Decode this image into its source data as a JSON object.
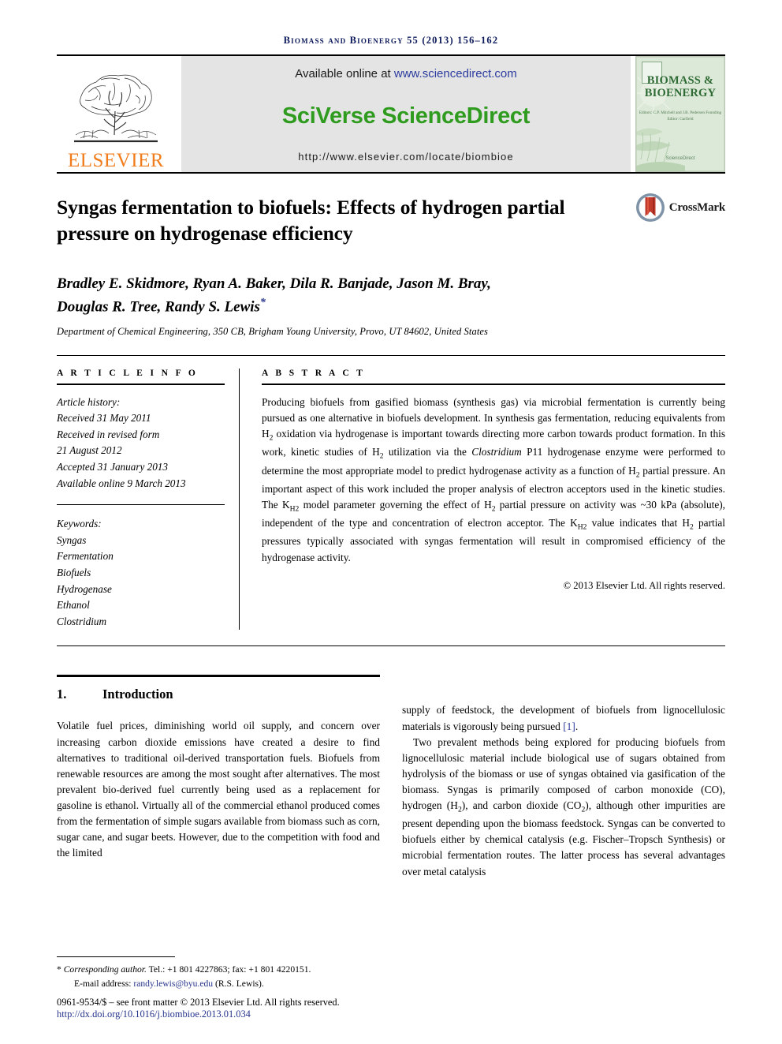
{
  "running_head": "Biomass and Bioenergy 55 (2013) 156–162",
  "banner": {
    "publisher_name": "ELSEVIER",
    "available_prefix": "Available online at ",
    "available_link": "www.sciencedirect.com",
    "platform_name": "SciVerse ScienceDirect",
    "journal_url": "http://www.elsevier.com/locate/biombioe",
    "cover": {
      "title_line1": "BIOMASS &",
      "title_line2": "BIOENERGY",
      "subtitle": "Editors: C.P. Mitchell and J.B. Pedersen\nFounding Editor: Garfield",
      "footer": "ScienceDirect"
    },
    "colors": {
      "elsevier_orange": "#f07c1b",
      "sciencedirect_green": "#2f9b1f",
      "link_blue": "#2b3b9e",
      "cover_green": "#2e6b34",
      "header_navy": "#0d1a5c"
    }
  },
  "article": {
    "title": "Syngas fermentation to biofuels: Effects of hydrogen partial pressure on hydrogenase efficiency",
    "crossmark_label": "CrossMark",
    "authors_line1": "Bradley E. Skidmore, Ryan A. Baker, Dila R. Banjade, Jason M. Bray,",
    "authors_line2": "Douglas R. Tree, Randy S. Lewis",
    "corresponding_marker": "*",
    "affiliation": "Department of Chemical Engineering, 350 CB, Brigham Young University, Provo, UT 84602, United States"
  },
  "article_info": {
    "heading": "A R T I C L E   I N F O",
    "history_label": "Article history:",
    "history": [
      "Received 31 May 2011",
      "Received in revised form",
      "21 August 2012",
      "Accepted 31 January 2013",
      "Available online 9 March 2013"
    ],
    "keywords_label": "Keywords:",
    "keywords": [
      "Syngas",
      "Fermentation",
      "Biofuels",
      "Hydrogenase",
      "Ethanol",
      "Clostridium"
    ]
  },
  "abstract": {
    "heading": "A B S T R A C T",
    "paragraph_parts": [
      "Producing biofuels from gasified biomass (synthesis gas) via microbial fermentation is currently being pursued as one alternative in biofuels development. In synthesis gas fermentation, reducing equivalents from H",
      "2",
      " oxidation via hydrogenase is important towards directing more carbon towards product formation. In this work, kinetic studies of H",
      "2",
      " utilization via the ",
      "Clostridium",
      " P11 hydrogenase enzyme were performed to determine the most appropriate model to predict hydrogenase activity as a function of H",
      "2",
      " partial pressure. An important aspect of this work included the proper analysis of electron acceptors used in the kinetic studies. The K",
      "H2",
      " model parameter governing the effect of H",
      "2",
      " partial pressure on activity was ~30 kPa (absolute), independent of the type and concentration of electron acceptor. The K",
      "H2",
      " value indicates that H",
      "2",
      " partial pressures typically associated with syngas fermentation will result in compromised efficiency of the hydrogenase activity."
    ],
    "copyright": "© 2013 Elsevier Ltd. All rights reserved."
  },
  "body": {
    "section_number": "1.",
    "section_title": "Introduction",
    "left_paragraph": "Volatile fuel prices, diminishing world oil supply, and concern over increasing carbon dioxide emissions have created a desire to find alternatives to traditional oil-derived transportation fuels. Biofuels from renewable resources are among the most sought after alternatives. The most prevalent bio-derived fuel currently being used as a replacement for gasoline is ethanol. Virtually all of the commercial ethanol produced comes from the fermentation of simple sugars available from biomass such as corn, sugar cane, and sugar beets. However, due to the competition with food and the limited",
    "right_paragraph_1_pre": "supply of feedstock, the development of biofuels from lignocellulosic materials is vigorously being pursued ",
    "right_paragraph_1_ref": "[1]",
    "right_paragraph_1_post": ".",
    "right_paragraph_2_pre": "Two prevalent methods being explored for producing biofuels from lignocellulosic material include biological use of sugars obtained from hydrolysis of the biomass or use of syngas obtained via gasification of the biomass. Syngas is primarily composed of carbon monoxide (CO), hydrogen (H",
    "right_paragraph_2_sub1": "2",
    "right_paragraph_2_mid": "), and carbon dioxide (CO",
    "right_paragraph_2_sub2": "2",
    "right_paragraph_2_post": "), although other impurities are present depending upon the biomass feedstock. Syngas can be converted to biofuels either by chemical catalysis (e.g. Fischer–Tropsch Synthesis) or microbial fermentation routes. The latter process has several advantages over metal catalysis"
  },
  "footer": {
    "corresponding_marker": "*",
    "corresponding_text": "Corresponding author.",
    "tel_fax": " Tel.: +1 801 4227863; fax: +1 801 4220151.",
    "email_label": "E-mail address: ",
    "email": "randy.lewis@byu.edu",
    "email_suffix": " (R.S. Lewis).",
    "issn_line": "0961-9534/$ – see front matter © 2013 Elsevier Ltd. All rights reserved.",
    "doi": "http://dx.doi.org/10.1016/j.biombioe.2013.01.034"
  }
}
